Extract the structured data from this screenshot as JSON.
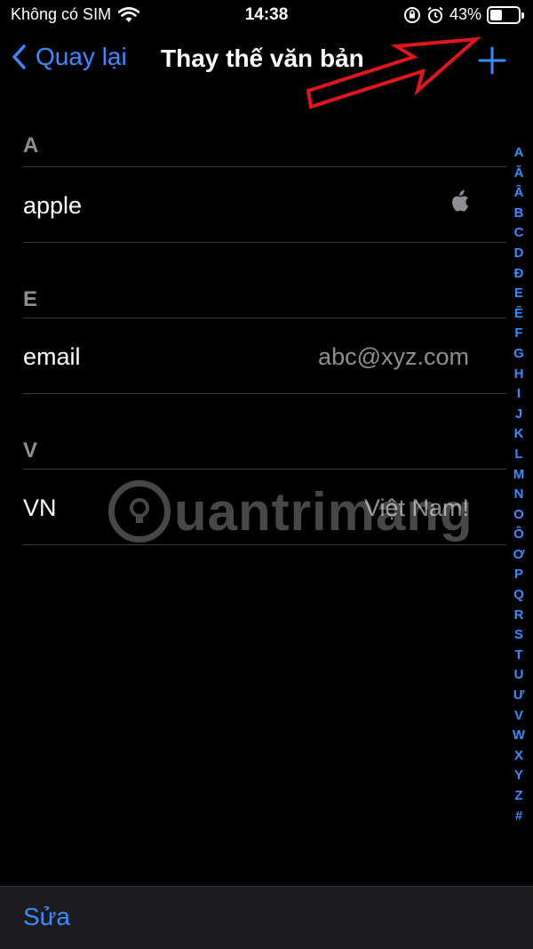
{
  "status_bar": {
    "carrier": "Không có SIM",
    "time": "14:38",
    "battery_percent": "43%",
    "battery_level": 0.43,
    "icons": [
      "wifi-icon",
      "orientation-lock-icon",
      "alarm-icon",
      "battery-icon"
    ]
  },
  "nav": {
    "back_label": "Quay lại",
    "title": "Thay thế văn bản",
    "add_icon": "plus-icon"
  },
  "sections": [
    {
      "letter": "A",
      "rows": [
        {
          "phrase": "apple",
          "shortcut": "",
          "shortcut_icon": "apple-logo-icon"
        }
      ]
    },
    {
      "letter": "E",
      "rows": [
        {
          "phrase": "email",
          "shortcut": "abc@xyz.com"
        }
      ]
    },
    {
      "letter": "V",
      "rows": [
        {
          "phrase": "VN",
          "shortcut": "Việt Nam!"
        }
      ]
    }
  ],
  "index_letters": [
    "A",
    "Ă",
    "Â",
    "B",
    "C",
    "D",
    "Đ",
    "E",
    "Ê",
    "F",
    "G",
    "H",
    "I",
    "J",
    "K",
    "L",
    "M",
    "N",
    "O",
    "Ô",
    "Ơ",
    "P",
    "Q",
    "R",
    "S",
    "T",
    "U",
    "Ư",
    "V",
    "W",
    "X",
    "Y",
    "Z",
    "#"
  ],
  "toolbar": {
    "edit_label": "Sửa"
  },
  "watermark": {
    "text": "uantrimang"
  },
  "colors": {
    "accent": "#3a8bff",
    "secondary_text": "#8e8e93",
    "separator": "#3a3a3c",
    "annotation": "#e0161b"
  }
}
